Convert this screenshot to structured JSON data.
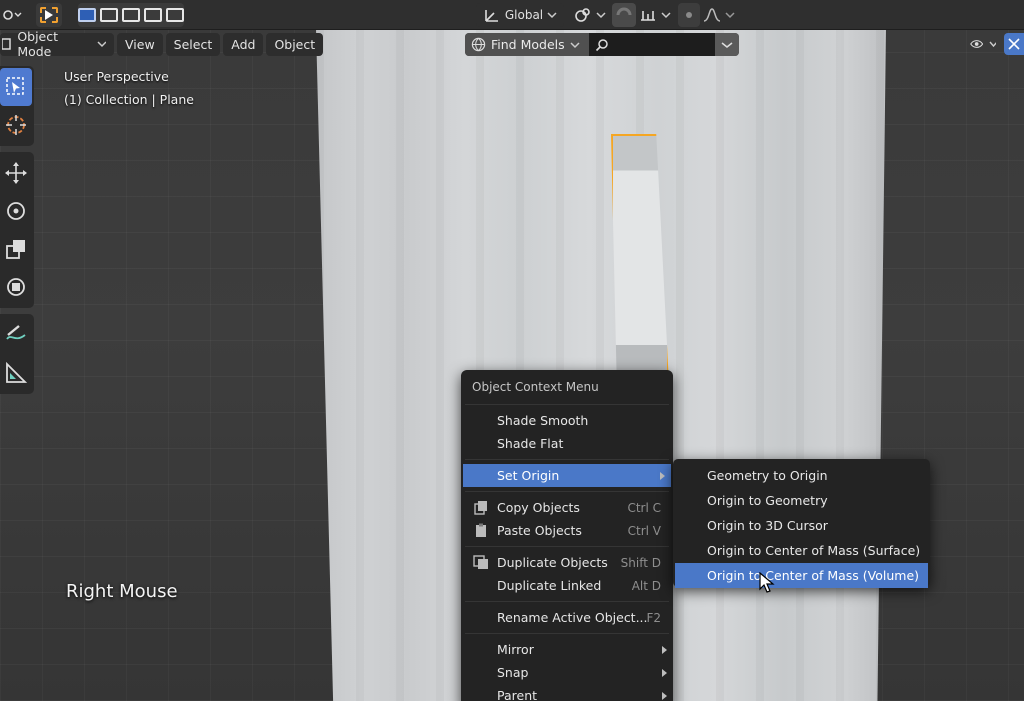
{
  "header": {
    "orientation": "Global",
    "icons": [
      "selection-mode-icon",
      "select-box-icon",
      "transform-orientation-icon",
      "snap-icon",
      "proportional-edit-icon"
    ]
  },
  "menubar": {
    "mode": "Object Mode",
    "menus": [
      "View",
      "Select",
      "Add",
      "Object"
    ],
    "find_label": "Find Models",
    "search_value": ""
  },
  "overlay": {
    "perspective": "User Perspective",
    "collection": "(1) Collection | Plane",
    "key_hint": "Right Mouse"
  },
  "toolbar": {
    "tools": [
      "select-box-icon",
      "cursor-icon",
      "move-icon",
      "rotate-icon",
      "scale-icon",
      "transform-icon",
      "annotate-icon",
      "measure-icon"
    ]
  },
  "context_menu": {
    "title": "Object Context Menu",
    "items": {
      "shade_smooth": "Shade Smooth",
      "shade_flat": "Shade Flat",
      "set_origin": "Set Origin",
      "copy_objects": "Copy Objects",
      "copy_shortcut": "Ctrl C",
      "paste_objects": "Paste Objects",
      "paste_shortcut": "Ctrl V",
      "duplicate_objects": "Duplicate Objects",
      "duplicate_shortcut": "Shift D",
      "duplicate_linked": "Duplicate Linked",
      "linked_shortcut": "Alt D",
      "rename": "Rename Active Object...",
      "rename_shortcut": "F2",
      "mirror": "Mirror",
      "snap": "Snap",
      "parent": "Parent"
    }
  },
  "submenu": {
    "items": [
      "Geometry to Origin",
      "Origin to Geometry",
      "Origin to 3D Cursor",
      "Origin to Center of Mass (Surface)",
      "Origin to Center of Mass (Volume)"
    ],
    "highlighted_index": 4
  },
  "colors": {
    "accent": "#4a78c8",
    "selection_outline": "#f5a623",
    "menu_bg": "#232323"
  }
}
